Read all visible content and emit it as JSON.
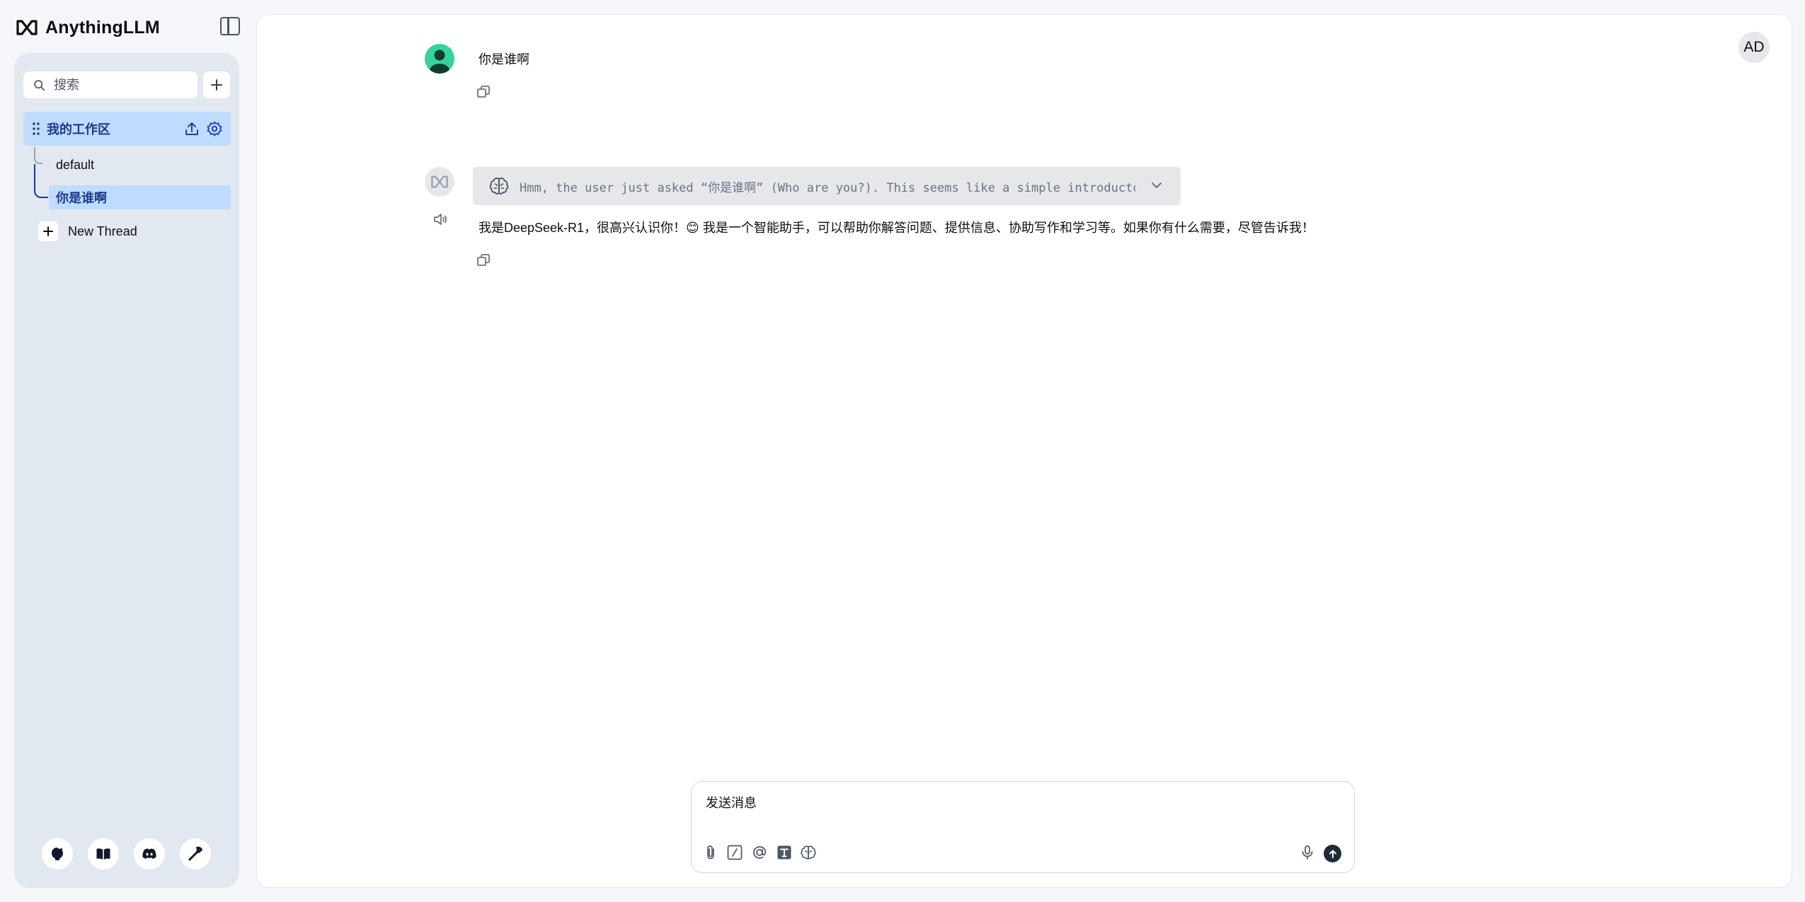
{
  "app": {
    "brand_name": "AnythingLLM"
  },
  "sidebar": {
    "search_placeholder": "搜索",
    "workspace": {
      "name": "我的工作区"
    },
    "threads": [
      {
        "label": "default",
        "active": false
      },
      {
        "label": "你是谁啊",
        "active": true
      }
    ],
    "new_thread_label": "New Thread",
    "footer_icons": [
      "github-icon",
      "docs-book-icon",
      "discord-icon",
      "settings-wrench-icon"
    ]
  },
  "header": {
    "user_initials": "AD"
  },
  "chat": {
    "user_message": "你是谁啊",
    "thinking_preview": "Hmm, the user just asked “你是谁啊” (Who are you?). This seems like a simple introductory …",
    "assistant_answer": "我是DeepSeek-R1，很高兴认识你！😊 我是一个智能助手，可以帮助你解答问题、提供信息、协助写作和学习等。如果你有什么需要，尽管告诉我！"
  },
  "composer": {
    "placeholder": "发送消息",
    "tools": [
      "attach-icon",
      "slash-command-icon",
      "at-mention-icon",
      "text-format-icon",
      "agent-brain-icon"
    ]
  },
  "colors": {
    "accent_active_bg": "#bfdbfe",
    "accent_active_text": "#1e3a8a",
    "sidebar_bg": "#e2e8f0",
    "page_bg": "#f4f6f9",
    "user_avatar": "#34d399"
  }
}
